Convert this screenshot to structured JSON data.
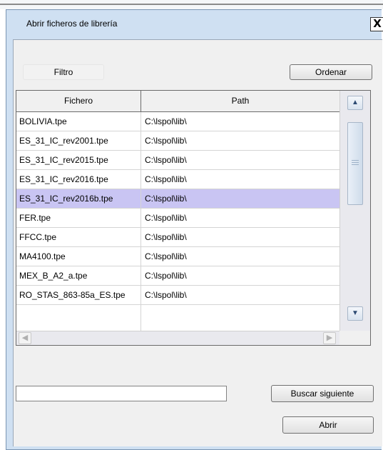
{
  "dialog": {
    "title": "Abrir ficheros de librería",
    "close_glyph": "X"
  },
  "toolbar": {
    "filter_label": "Filtro",
    "sort_label": "Ordenar"
  },
  "table": {
    "columns": [
      "Fichero",
      "Path"
    ],
    "rows": [
      {
        "file": "BOLIVIA.tpe",
        "path": "C:\\lspol\\lib\\"
      },
      {
        "file": "ES_31_IC_rev2001.tpe",
        "path": "C:\\lspol\\lib\\"
      },
      {
        "file": "ES_31_IC_rev2015.tpe",
        "path": "C:\\lspol\\lib\\"
      },
      {
        "file": "ES_31_IC_rev2016.tpe",
        "path": "C:\\lspol\\lib\\"
      },
      {
        "file": "ES_31_IC_rev2016b.tpe",
        "path": "C:\\lspol\\lib\\"
      },
      {
        "file": "FER.tpe",
        "path": "C:\\lspol\\lib\\"
      },
      {
        "file": "FFCC.tpe",
        "path": "C:\\lspol\\lib\\"
      },
      {
        "file": "MA4100.tpe",
        "path": "C:\\lspol\\lib\\"
      },
      {
        "file": "MEX_B_A2_a.tpe",
        "path": "C:\\lspol\\lib\\"
      },
      {
        "file": "RO_STAS_863-85a_ES.tpe",
        "path": "C:\\lspol\\lib\\"
      }
    ],
    "selected_index": 4
  },
  "search": {
    "value": "",
    "next_label": "Buscar siguiente"
  },
  "footer": {
    "open_label": "Abrir"
  },
  "colors": {
    "window_frame": "#cfe0f2",
    "selection": "#c9c5f3",
    "client": "#f0f0f0"
  }
}
